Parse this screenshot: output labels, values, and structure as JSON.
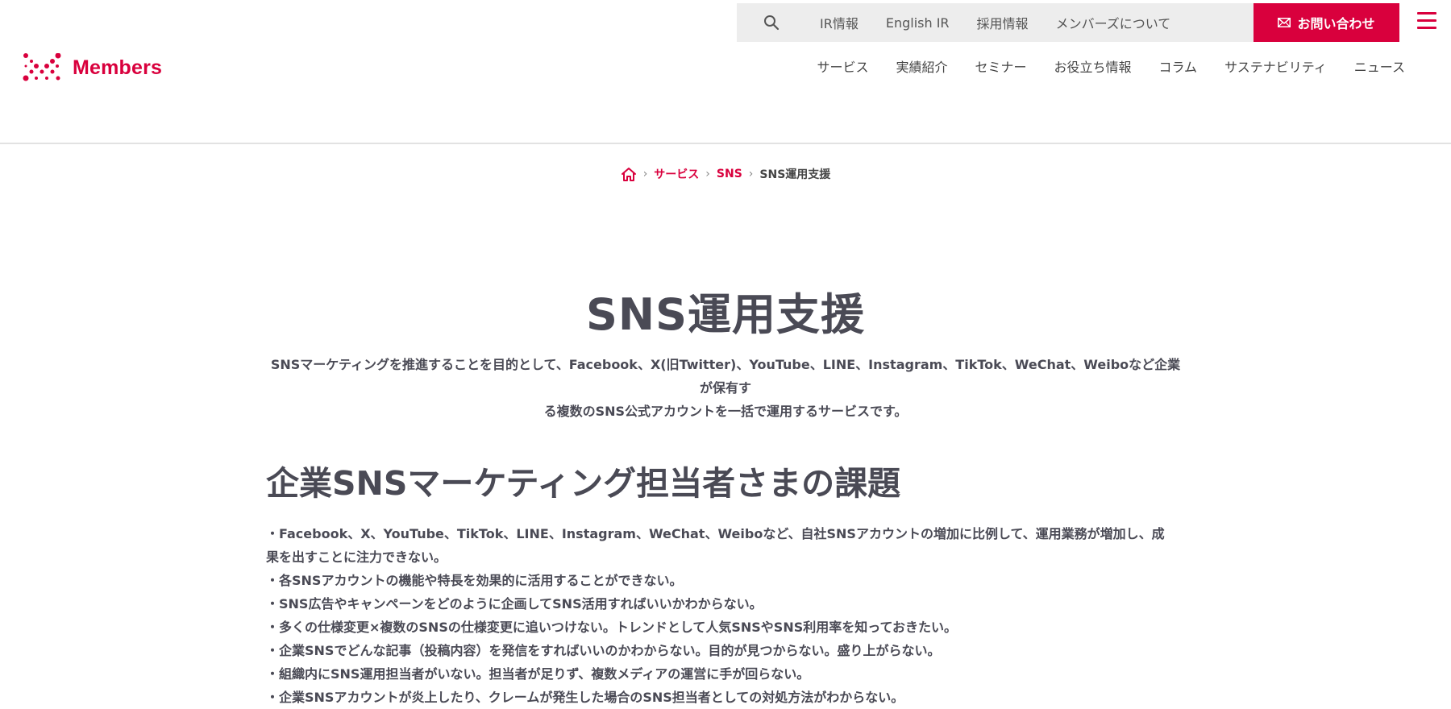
{
  "header": {
    "logo_text": "Members",
    "brand_color": "#d9003d",
    "utility_nav": [
      {
        "label": "IR情報"
      },
      {
        "label": "English IR"
      },
      {
        "label": "採用情報"
      },
      {
        "label": "メンバーズについて"
      }
    ],
    "contact_label": "お問い合わせ",
    "search_icon": "search-icon",
    "menu_icon": "hamburger-menu-icon",
    "global_nav": [
      {
        "label": "サービス"
      },
      {
        "label": "実績紹介"
      },
      {
        "label": "セミナー"
      },
      {
        "label": "お役立ち情報"
      },
      {
        "label": "コラム"
      },
      {
        "label": "サステナビリティ"
      },
      {
        "label": "ニュース"
      }
    ]
  },
  "breadcrumb": {
    "home_icon": "home-icon",
    "items": [
      {
        "label": "サービス"
      },
      {
        "label": "SNS"
      }
    ],
    "current": "SNS運用支援"
  },
  "main": {
    "title": "SNS運用支援",
    "lead_line1": "SNSマーケティングを推進することを目的として、Facebook、X(旧Twitter)、YouTube、LINE、Instagram、TikTok、WeChat、Weiboなど企業が保有す",
    "lead_line2": "る複数のSNS公式アカウントを一括で運用するサービスです。",
    "section_heading": "企業SNSマーケティング担当者さまの課題",
    "issues": [
      "・Facebook、X、YouTube、TikTok、LINE、Instagram、WeChat、Weiboなど、自社SNSアカウントの増加に比例して、運用業務が増加し、成果を出すことに注力できない。",
      "・各SNSアカウントの機能や特長を効果的に活用することができない。",
      "・SNS広告やキャンペーンをどのように企画してSNS活用すればいいかわからない。",
      "・多くの仕様変更×複数のSNSの仕様変更に追いつけない。トレンドとして人気SNSやSNS利用率を知っておきたい。",
      "・企業SNSでどんな記事（投稿内容）を発信をすればいいのかわからない。目的が見つからない。盛り上がらない。",
      "・組織内にSNS運用担当者がいない。担当者が足りず、複数メディアの運営に手が回らない。",
      "・企業SNSアカウントが炎上したり、クレームが発生した場合のSNS担当者としての対処方法がわからない。"
    ]
  }
}
